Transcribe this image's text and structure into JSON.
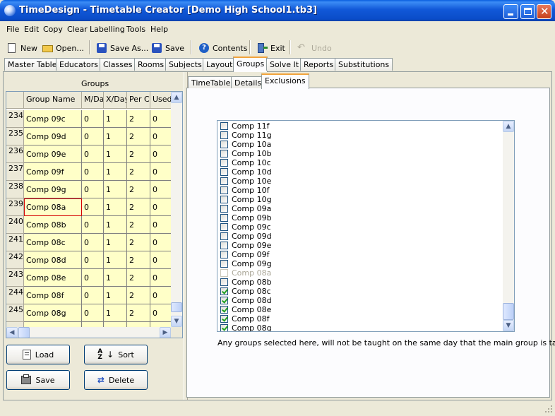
{
  "window": {
    "title": "TimeDesign - Timetable Creator [Demo High School1.tb3]"
  },
  "menu": [
    "File",
    "Edit",
    "Copy",
    "Clear",
    "Labelling",
    "Tools",
    "Help"
  ],
  "toolbar": {
    "new": "New",
    "open": "Open...",
    "save_as": "Save As...",
    "save": "Save",
    "contents": "Contents",
    "exit": "Exit",
    "undo": "Undo"
  },
  "main_tabs": [
    "Master Table",
    "Educators",
    "Classes",
    "Rooms",
    "Subjects",
    "Layout",
    "Groups",
    "Solve It",
    "Reports",
    "Substitutions"
  ],
  "active_main_tab": "Groups",
  "groups": {
    "title": "Groups",
    "columns": [
      "Group Name",
      "M/Da",
      "X/Day",
      "Per Cy",
      "Used"
    ],
    "rows": [
      {
        "num": "234",
        "name": "Comp 09c",
        "m": "0",
        "x": "1",
        "per": "2",
        "used": "0"
      },
      {
        "num": "235",
        "name": "Comp 09d",
        "m": "0",
        "x": "1",
        "per": "2",
        "used": "0"
      },
      {
        "num": "236",
        "name": "Comp 09e",
        "m": "0",
        "x": "1",
        "per": "2",
        "used": "0"
      },
      {
        "num": "237",
        "name": "Comp 09f",
        "m": "0",
        "x": "1",
        "per": "2",
        "used": "0"
      },
      {
        "num": "238",
        "name": "Comp 09g",
        "m": "0",
        "x": "1",
        "per": "2",
        "used": "0"
      },
      {
        "num": "239",
        "name": "Comp 08a",
        "m": "0",
        "x": "1",
        "per": "2",
        "used": "0"
      },
      {
        "num": "240",
        "name": "Comp 08b",
        "m": "0",
        "x": "1",
        "per": "2",
        "used": "0"
      },
      {
        "num": "241",
        "name": "Comp 08c",
        "m": "0",
        "x": "1",
        "per": "2",
        "used": "0"
      },
      {
        "num": "242",
        "name": "Comp 08d",
        "m": "0",
        "x": "1",
        "per": "2",
        "used": "0"
      },
      {
        "num": "243",
        "name": "Comp 08e",
        "m": "0",
        "x": "1",
        "per": "2",
        "used": "0"
      },
      {
        "num": "244",
        "name": "Comp 08f",
        "m": "0",
        "x": "1",
        "per": "2",
        "used": "0"
      },
      {
        "num": "245",
        "name": "Comp 08g",
        "m": "0",
        "x": "1",
        "per": "2",
        "used": "0"
      }
    ],
    "selected_row": "239"
  },
  "buttons": {
    "load": "Load",
    "sort": "Sort",
    "save": "Save",
    "delete": "Delete"
  },
  "sub_tabs": [
    "TimeTable",
    "Details",
    "Exclusions"
  ],
  "active_sub_tab": "Exclusions",
  "exclusions": [
    {
      "label": "Comp 11f",
      "checked": false,
      "disabled": false
    },
    {
      "label": "Comp 11g",
      "checked": false,
      "disabled": false
    },
    {
      "label": "Comp 10a",
      "checked": false,
      "disabled": false
    },
    {
      "label": "Comp 10b",
      "checked": false,
      "disabled": false
    },
    {
      "label": "Comp 10c",
      "checked": false,
      "disabled": false
    },
    {
      "label": "Comp 10d",
      "checked": false,
      "disabled": false
    },
    {
      "label": "Comp 10e",
      "checked": false,
      "disabled": false
    },
    {
      "label": "Comp 10f",
      "checked": false,
      "disabled": false
    },
    {
      "label": "Comp 10g",
      "checked": false,
      "disabled": false
    },
    {
      "label": "Comp 09a",
      "checked": false,
      "disabled": false
    },
    {
      "label": "Comp 09b",
      "checked": false,
      "disabled": false
    },
    {
      "label": "Comp 09c",
      "checked": false,
      "disabled": false
    },
    {
      "label": "Comp 09d",
      "checked": false,
      "disabled": false
    },
    {
      "label": "Comp 09e",
      "checked": false,
      "disabled": false
    },
    {
      "label": "Comp 09f",
      "checked": false,
      "disabled": false
    },
    {
      "label": "Comp 09g",
      "checked": false,
      "disabled": false
    },
    {
      "label": "Comp 08a",
      "checked": false,
      "disabled": true
    },
    {
      "label": "Comp 08b",
      "checked": false,
      "disabled": false
    },
    {
      "label": "Comp 08c",
      "checked": true,
      "disabled": false
    },
    {
      "label": "Comp 08d",
      "checked": true,
      "disabled": false
    },
    {
      "label": "Comp 08e",
      "checked": true,
      "disabled": false
    },
    {
      "label": "Comp 08f",
      "checked": true,
      "disabled": false
    },
    {
      "label": "Comp 08g",
      "checked": true,
      "disabled": false
    }
  ],
  "exclusions_note": "Any groups selected here, will not be taught on the same day that the main group is taught.",
  "colors": {
    "title_bar": "#0a4cc8",
    "grid_cell": "#ffffc8",
    "selected_border": "#d40000",
    "active_tab_accent": "#f1a33c",
    "check_mark": "#21a121"
  }
}
